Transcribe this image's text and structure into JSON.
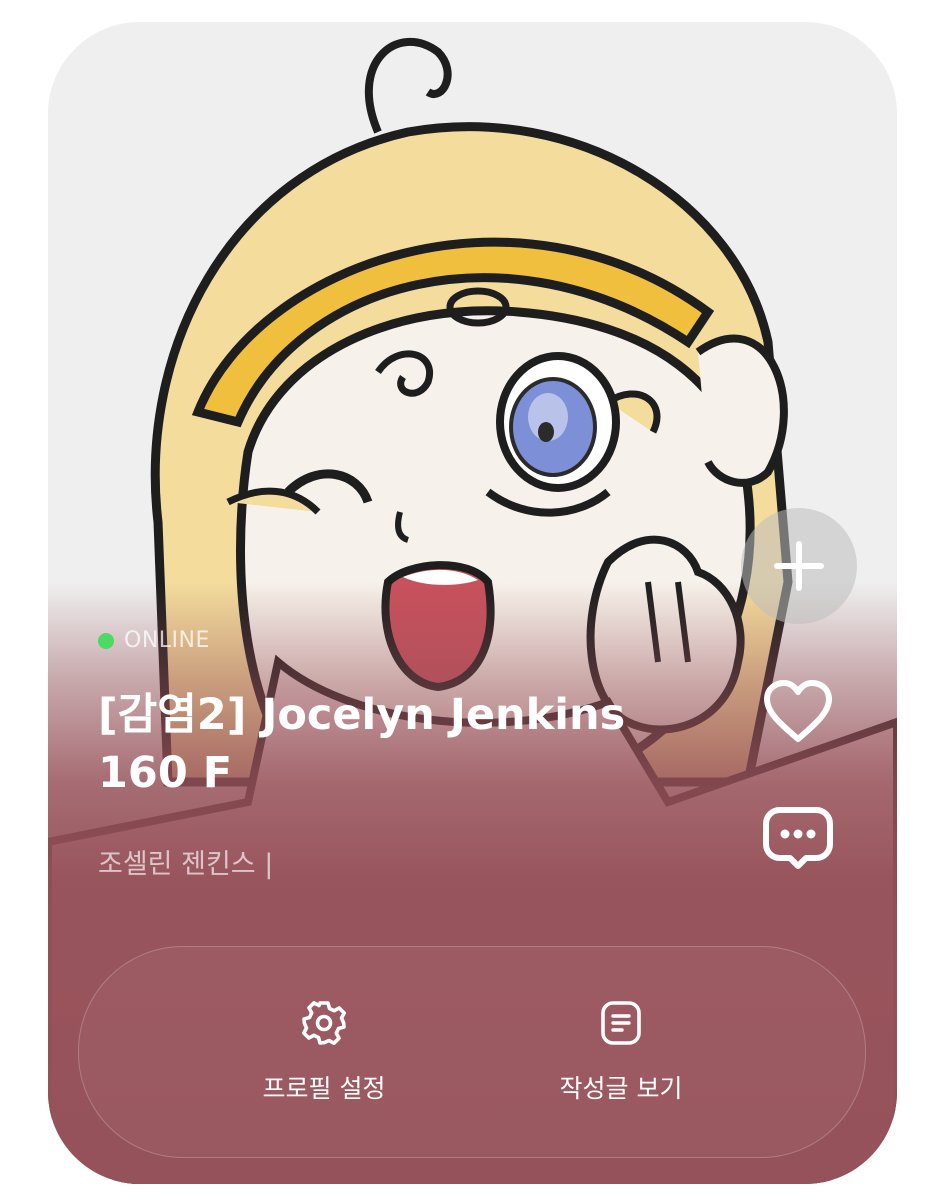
{
  "profile": {
    "status": "ONLINE",
    "name": "[감염2] Jocelyn Jenkins 160 F",
    "subname": "조셀린 젠킨스 |",
    "status_color": "#4cd964",
    "card_accent": "#96525a"
  },
  "side_actions": {
    "add_icon": "plus-icon",
    "like_icon": "heart-icon",
    "chat_icon": "chat-bubble-icon"
  },
  "actions": {
    "settings_label": "프로필 설정",
    "posts_label": "작성글 보기"
  }
}
